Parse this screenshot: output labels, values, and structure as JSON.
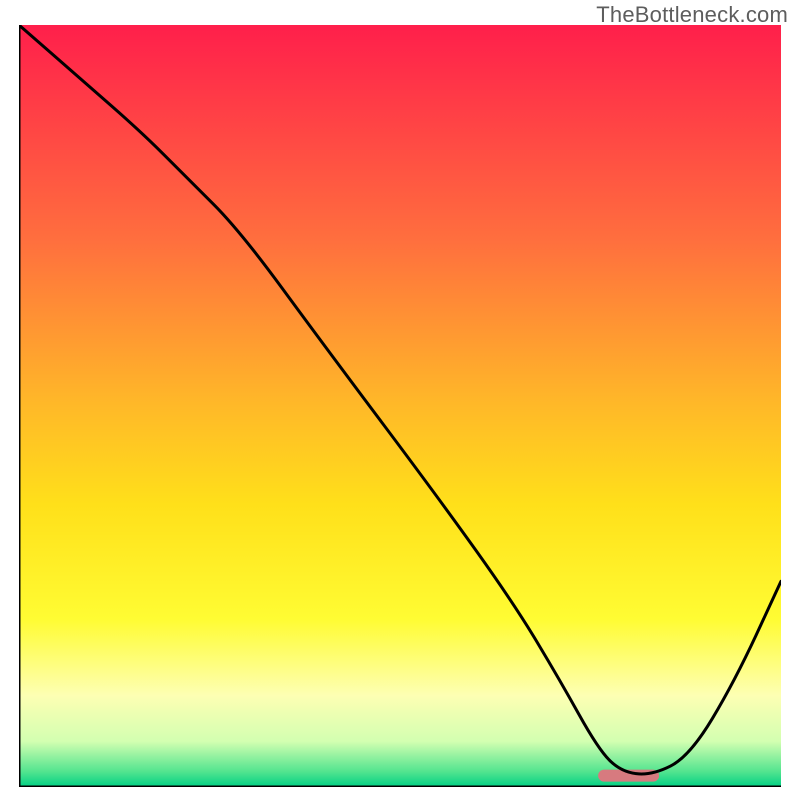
{
  "watermark": "TheBottleneck.com",
  "chart_data": {
    "type": "line",
    "title": "",
    "xlabel": "",
    "ylabel": "",
    "xlim": [
      0,
      100
    ],
    "ylim": [
      0,
      100
    ],
    "grid": false,
    "background_gradient_stops": [
      {
        "offset": 0,
        "color": "#ff1f4b"
      },
      {
        "offset": 28,
        "color": "#ff6e3e"
      },
      {
        "offset": 50,
        "color": "#ffb928"
      },
      {
        "offset": 63,
        "color": "#ffe01a"
      },
      {
        "offset": 78,
        "color": "#fffc33"
      },
      {
        "offset": 88,
        "color": "#fdffb3"
      },
      {
        "offset": 94,
        "color": "#d3ffb1"
      },
      {
        "offset": 98,
        "color": "#52e48f"
      },
      {
        "offset": 100,
        "color": "#00d084"
      }
    ],
    "series": [
      {
        "name": "bottleneck-curve",
        "x": [
          0,
          8,
          16,
          22,
          29,
          40,
          55,
          65,
          71,
          76,
          79,
          83,
          88,
          94,
          100
        ],
        "y": [
          100,
          93,
          86,
          80,
          73,
          58,
          38,
          24,
          14,
          5,
          2,
          1.5,
          4,
          14,
          27
        ]
      }
    ],
    "marker": {
      "name": "optimal-range",
      "x_start": 76,
      "x_end": 84,
      "y": 1.5,
      "color": "#d77a7f",
      "thickness": 12
    }
  }
}
